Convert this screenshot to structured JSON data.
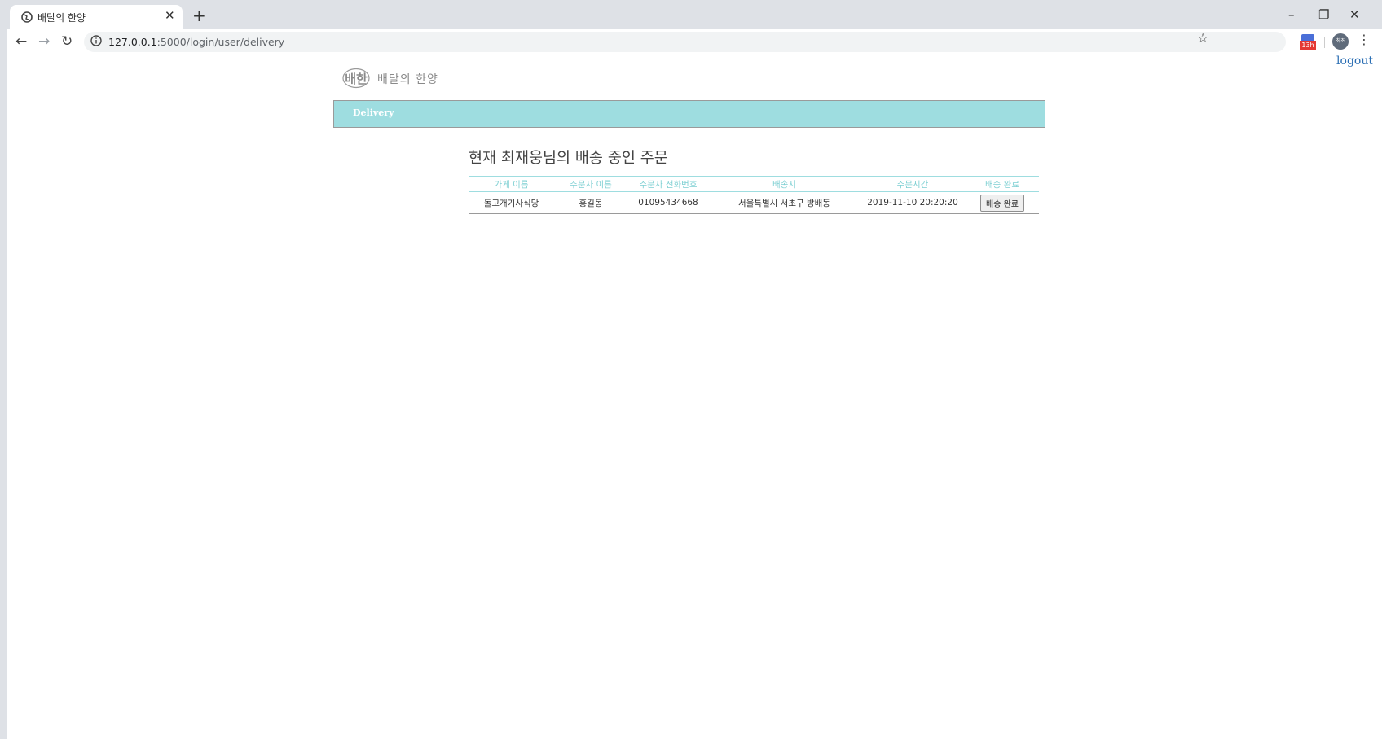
{
  "browser": {
    "tab_title": "배달의 한양",
    "url_host": "127.0.0.1",
    "url_rest": ":5000/login/user/delivery",
    "extension_badge": "13h",
    "profile_initials": "최초"
  },
  "page": {
    "logout_label": "logout",
    "logo_mark": "배한",
    "logo_name": "배달의 한양",
    "nav_delivery_label": "Delivery",
    "heading": "현재 최재웅님의 배송 중인 주문"
  },
  "table": {
    "headers": [
      "가게 이름",
      "주문자 이름",
      "주문자 전화번호",
      "배송지",
      "주문시간",
      "배송 완료"
    ],
    "rows": [
      {
        "store_name": "돌고개기사식당",
        "orderer_name": "홍길동",
        "phone": "01095434668",
        "address": "서울특별시 서초구 방배동",
        "order_time": "2019-11-10 20:20:20",
        "complete_label": "배송 완료"
      }
    ]
  },
  "colors": {
    "navbar_bg": "#9edde0",
    "header_text": "#7fd0d3",
    "logout_link": "#2c6fb4"
  }
}
